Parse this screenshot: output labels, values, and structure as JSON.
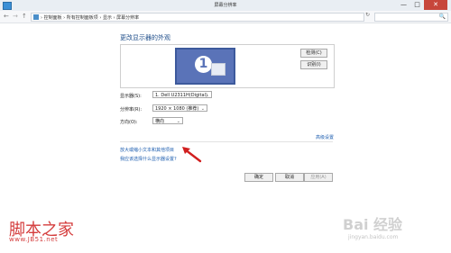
{
  "window": {
    "title": "屏幕分辨率",
    "minimize": "—",
    "maximize": "□",
    "close": "✕",
    "app_icon": "display-settings-icon"
  },
  "navbar": {
    "back": "←",
    "forward": "→",
    "up": "↑",
    "breadcrumb": "› 控制面板 › 所有控制面板项 › 显示 › 屏幕分辨率",
    "refresh": "↻",
    "search_icon": "🔍"
  },
  "main": {
    "heading": "更改显示器的外观",
    "monitor_number": "1",
    "detect_label": "检测(C)",
    "identify_label": "识别(I)",
    "display_label": "显示器(S):",
    "display_value": "1. Dell U2311H(Digital)",
    "resolution_label": "分辨率(R):",
    "resolution_value": "1920 × 1080 (推荐)",
    "orientation_label": "方向(O):",
    "orientation_value": "横向",
    "advanced_link": "高级设置",
    "link_text_size": "放大或缩小文本和其他项目",
    "link_which_settings": "我应该选择什么显示器设置?"
  },
  "footer": {
    "ok": "确定",
    "cancel": "取消",
    "apply": "应用(A)"
  },
  "watermarks": {
    "left_text": "脚本之家",
    "left_url": "www.JB51.net",
    "right_text": "Bai 经验",
    "right_url": "jingyan.baidu.com"
  },
  "colors": {
    "link": "#1f5fb0",
    "heading": "#1f4e8a",
    "monitor": "#5a73b8",
    "close_button": "#c7463b",
    "arrow": "#d11f1f"
  }
}
